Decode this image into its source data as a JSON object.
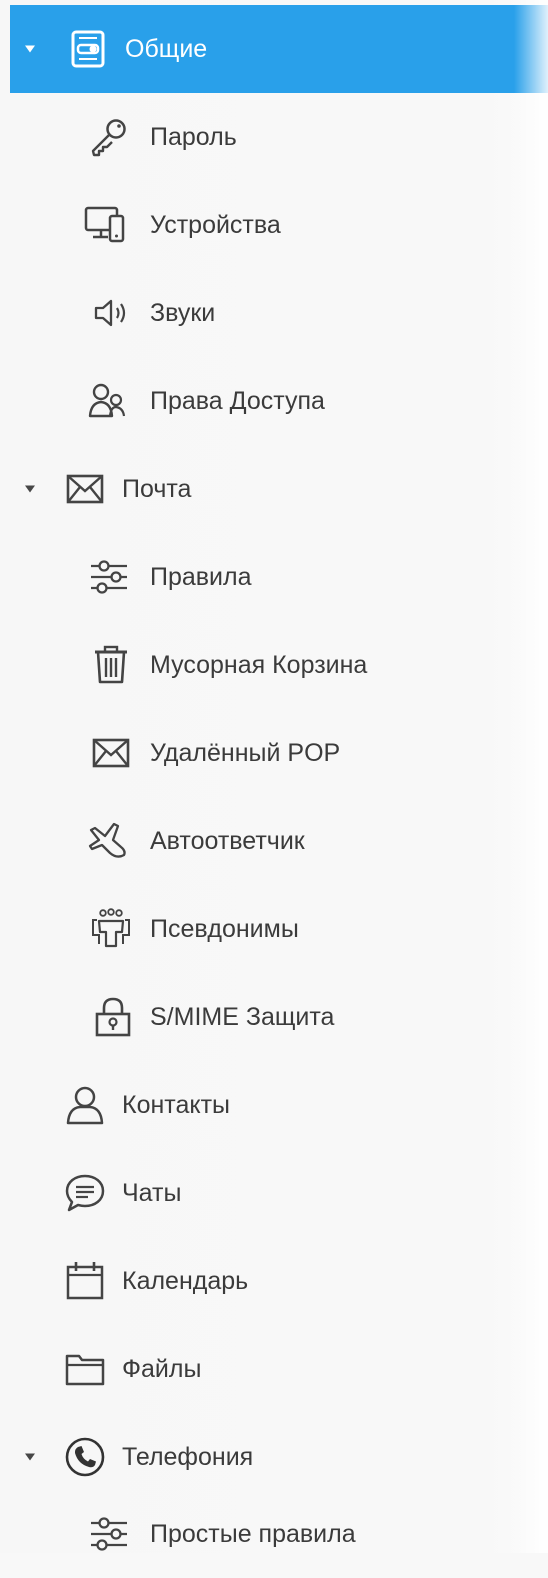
{
  "sidebar": {
    "items": [
      {
        "label": "Общие",
        "icon": "settings-panel-icon",
        "expanded": true,
        "active": true
      },
      {
        "label": "Пароль",
        "icon": "key-icon"
      },
      {
        "label": "Устройства",
        "icon": "devices-icon"
      },
      {
        "label": "Звуки",
        "icon": "speaker-icon"
      },
      {
        "label": "Права Доступа",
        "icon": "users-icon"
      },
      {
        "label": "Почта",
        "icon": "mail-icon",
        "expanded": true
      },
      {
        "label": "Правила",
        "icon": "sliders-icon"
      },
      {
        "label": "Мусорная Корзина",
        "icon": "trash-icon"
      },
      {
        "label": "Удалённый POP",
        "icon": "mail-icon"
      },
      {
        "label": "Автоответчик",
        "icon": "airplane-icon"
      },
      {
        "label": "Псевдонимы",
        "icon": "aliases-icon"
      },
      {
        "label": "S/MIME Защита",
        "icon": "lock-icon"
      },
      {
        "label": "Контакты",
        "icon": "contact-icon"
      },
      {
        "label": "Чаты",
        "icon": "chat-icon"
      },
      {
        "label": "Календарь",
        "icon": "calendar-icon"
      },
      {
        "label": "Файлы",
        "icon": "folder-icon"
      },
      {
        "label": "Телефония",
        "icon": "phone-icon",
        "expanded": true
      },
      {
        "label": "Простые правила",
        "icon": "sliders-icon"
      }
    ]
  },
  "colors": {
    "active_background": "#29a0ea",
    "text": "#3b3b3b",
    "panel_background": "#f8f8f8"
  }
}
